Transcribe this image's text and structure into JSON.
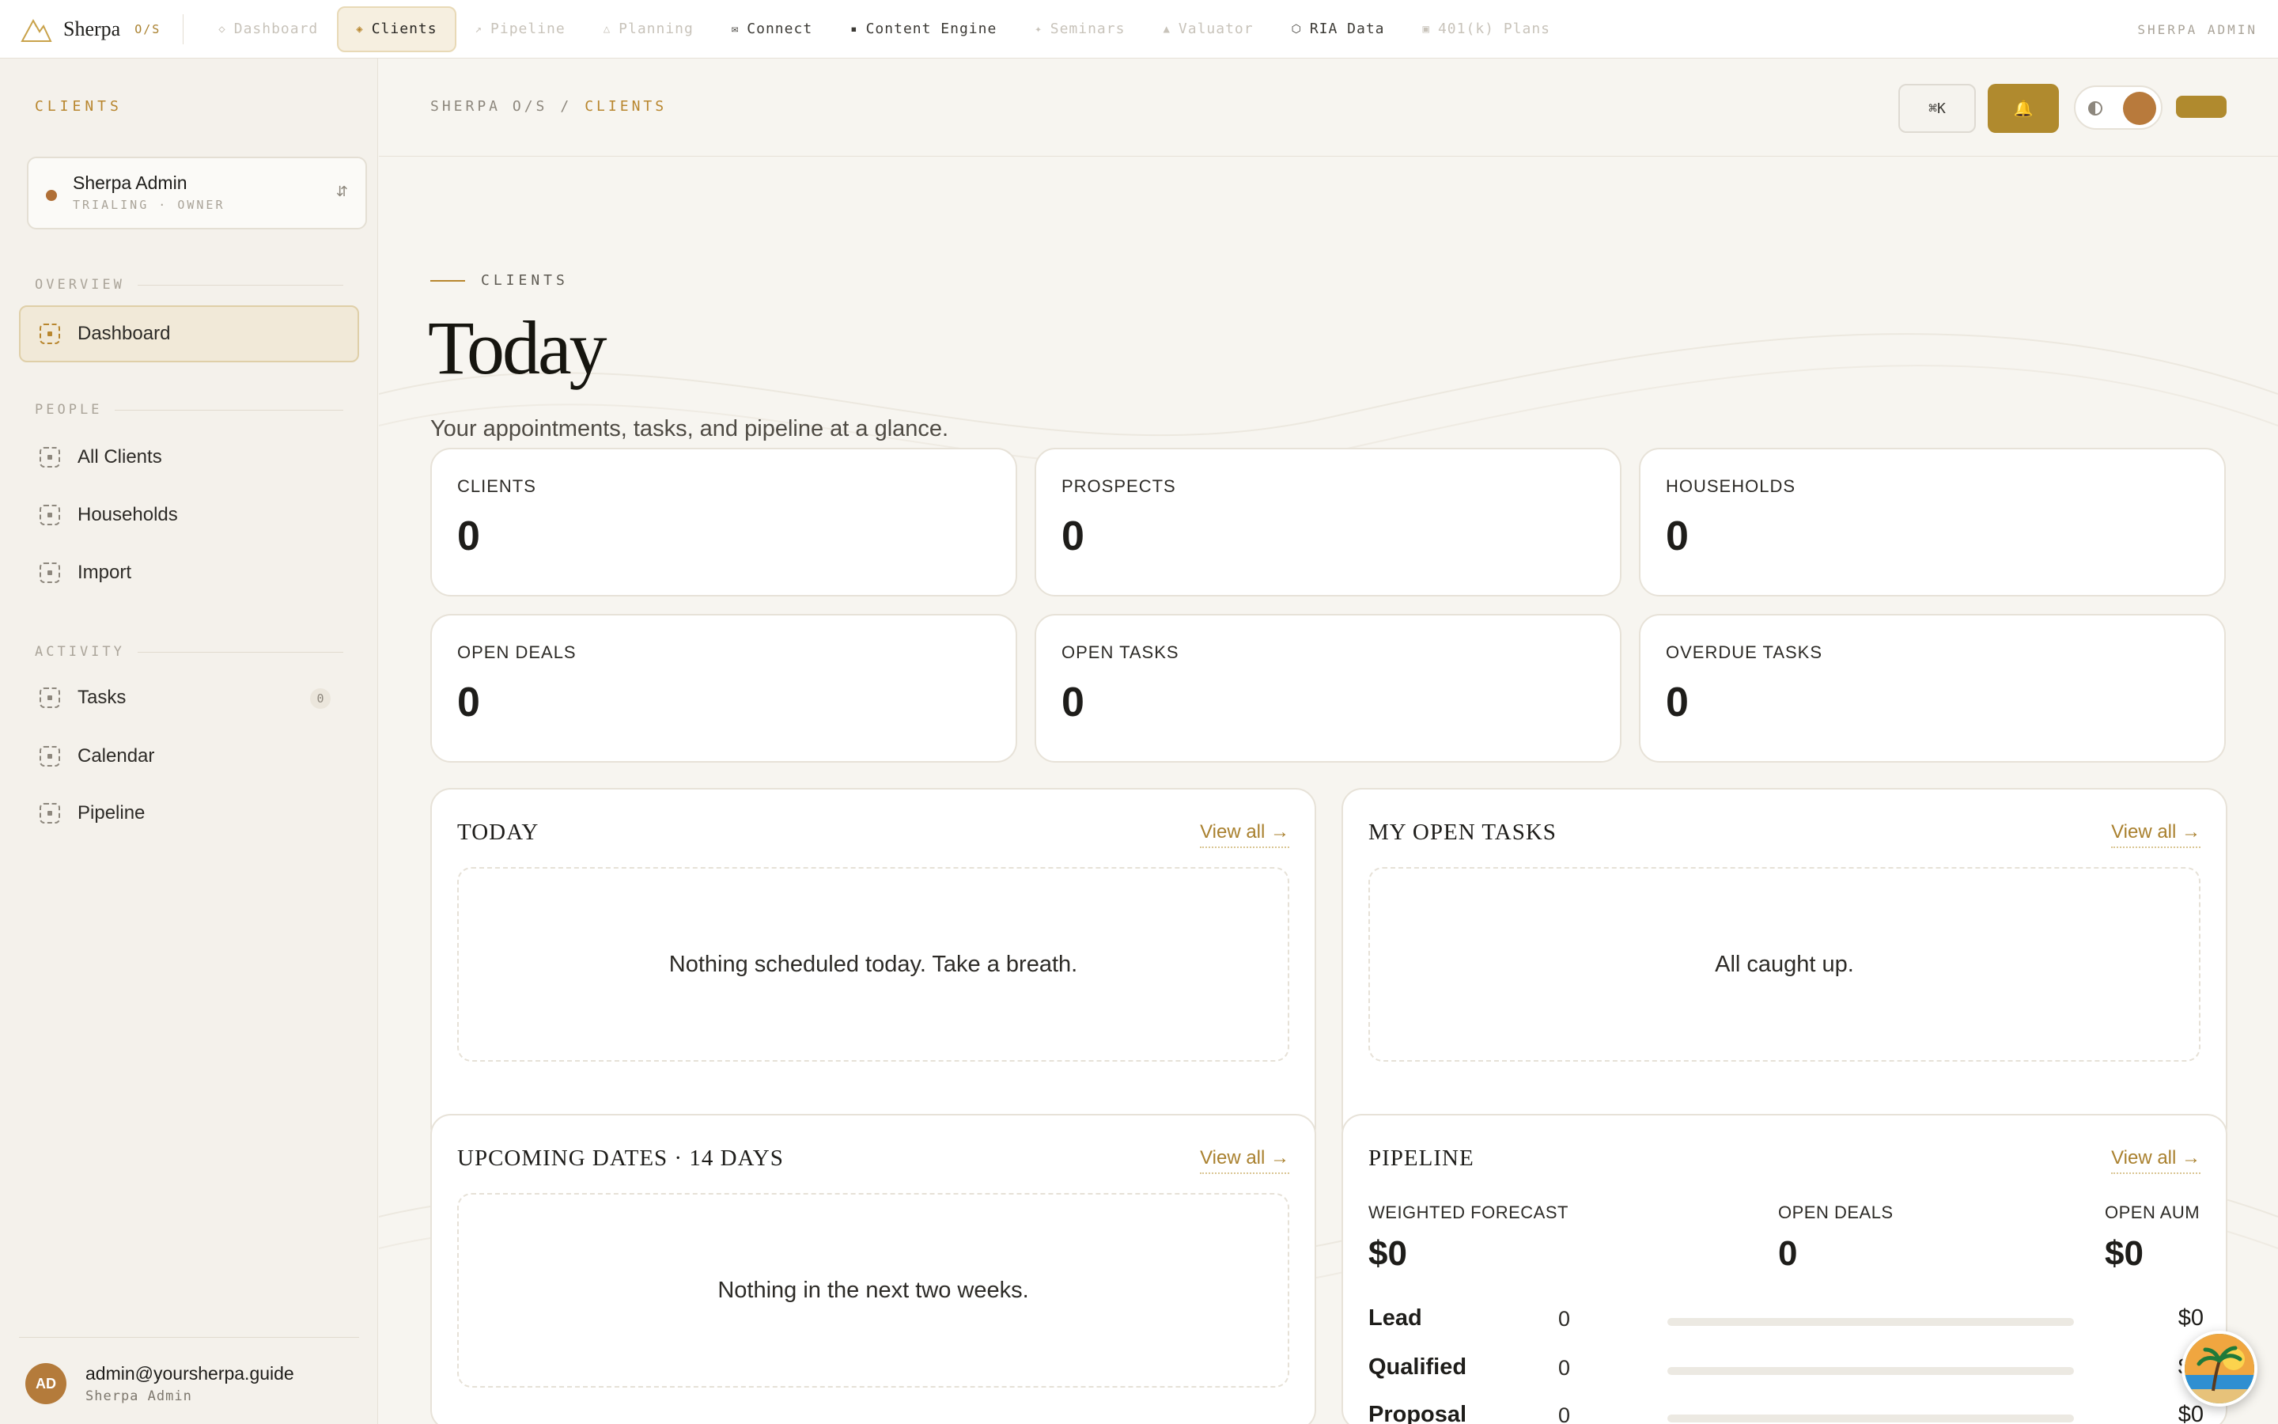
{
  "brand": {
    "name": "Sherpa",
    "tag": "O/S"
  },
  "topnav": {
    "items": [
      {
        "label": "Dashboard",
        "icon": "◇"
      },
      {
        "label": "Clients",
        "icon": "◈"
      },
      {
        "label": "Pipeline",
        "icon": "↗"
      },
      {
        "label": "Planning",
        "icon": "△"
      },
      {
        "label": "Connect",
        "icon": "✉"
      },
      {
        "label": "Content Engine",
        "icon": "▪"
      },
      {
        "label": "Seminars",
        "icon": "✦"
      },
      {
        "label": "Valuator",
        "icon": "▲"
      },
      {
        "label": "RIA Data",
        "icon": "⬡"
      },
      {
        "label": "401(k) Plans",
        "icon": "▣"
      }
    ],
    "user_label": "SHERPA ADMIN"
  },
  "sidebar": {
    "title": "CLIENTS",
    "org": {
      "name": "Sherpa Admin",
      "sub": "TRIALING · OWNER",
      "switch_icon": "⇵"
    },
    "sections": {
      "overview": "OVERVIEW",
      "people": "PEOPLE",
      "activity": "ACTIVITY"
    },
    "items": {
      "dashboard": "Dashboard",
      "all_clients": "All Clients",
      "households": "Households",
      "import": "Import",
      "tasks": "Tasks",
      "tasks_badge": "0",
      "calendar": "Calendar",
      "pipeline": "Pipeline"
    },
    "footer": {
      "initials": "AD",
      "email": "admin@yoursherpa.guide",
      "name": "Sherpa Admin"
    }
  },
  "header": {
    "crumb_root": "SHERPA O/S",
    "crumb_sep": "/",
    "crumb_current": "CLIENTS",
    "cmdk": "⌘K",
    "bell_icon": "🔔"
  },
  "page": {
    "eyebrow": "CLIENTS",
    "title": "Today",
    "subtitle": "Your appointments, tasks, and pipeline at a glance."
  },
  "stats": [
    {
      "label": "CLIENTS",
      "value": "0"
    },
    {
      "label": "PROSPECTS",
      "value": "0"
    },
    {
      "label": "HOUSEHOLDS",
      "value": "0"
    },
    {
      "label": "OPEN DEALS",
      "value": "0"
    },
    {
      "label": "OPEN TASKS",
      "value": "0"
    },
    {
      "label": "OVERDUE TASKS",
      "value": "0"
    }
  ],
  "panels": {
    "today": {
      "title": "TODAY",
      "view_all": "View all →",
      "empty": "Nothing scheduled today. Take a breath."
    },
    "tasks": {
      "title": "MY OPEN TASKS",
      "view_all": "View all →",
      "empty": "All caught up."
    },
    "upcoming": {
      "title": "UPCOMING DATES · 14 DAYS",
      "view_all": "View all →",
      "empty": "Nothing in the next two weeks."
    },
    "pipeline": {
      "title": "PIPELINE",
      "view_all": "View all →",
      "forecast_label": "WEIGHTED FORECAST",
      "forecast_value": "$0",
      "deals_label": "OPEN DEALS",
      "deals_value": "0",
      "aum_label": "OPEN AUM",
      "aum_value": "$0",
      "stages": [
        {
          "name": "Lead",
          "count": "0",
          "amount": "$0",
          "fill": 0
        },
        {
          "name": "Qualified",
          "count": "0",
          "amount": "$0",
          "fill": 0
        },
        {
          "name": "Proposal",
          "count": "0",
          "amount": "$0",
          "fill": 0
        }
      ]
    }
  },
  "colors": {
    "accent": "#b8862e",
    "background": "#f7f5f0",
    "card": "#ffffff",
    "avatar": "#b47b3b"
  }
}
